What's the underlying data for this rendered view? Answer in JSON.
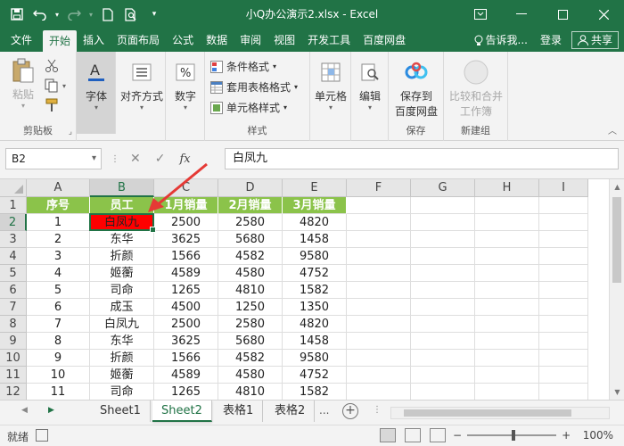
{
  "window": {
    "title": "小Q办公演示2.xlsx - Excel"
  },
  "ribbon_tabs": {
    "file": "文件",
    "home": "开始",
    "insert": "插入",
    "page_layout": "页面布局",
    "formulas": "公式",
    "data": "数据",
    "review": "审阅",
    "view": "视图",
    "developer": "开发工具",
    "baidu": "百度网盘",
    "tell_me": "告诉我...",
    "login": "登录",
    "share": "共享"
  },
  "ribbon": {
    "paste": "粘贴",
    "clipboard": "剪贴板",
    "font": "字体",
    "alignment": "对齐方式",
    "number": "数字",
    "conditional_format": "条件格式",
    "table_format": "套用表格格式",
    "cell_style": "单元格样式",
    "styles": "样式",
    "cells": "单元格",
    "edit": "编辑",
    "save_to_baidu_1": "保存到",
    "save_to_baidu_2": "百度网盘",
    "save": "保存",
    "compare_merge_1": "比较和合并",
    "compare_merge_2": "工作簿",
    "new_group": "新建组"
  },
  "formula_bar": {
    "name_box": "B2",
    "content": "白凤九",
    "fx": "fx"
  },
  "sheet": {
    "columns": [
      "A",
      "B",
      "C",
      "D",
      "E",
      "F",
      "G",
      "H",
      "I"
    ],
    "rows": [
      "1",
      "2",
      "3",
      "4",
      "5",
      "6",
      "7",
      "8",
      "9",
      "10",
      "11",
      "12"
    ],
    "header": [
      "序号",
      "员工",
      "1月销量",
      "2月销量",
      "3月销量"
    ],
    "data": [
      [
        "1",
        "白凤九",
        "2500",
        "2580",
        "4820"
      ],
      [
        "2",
        "东华",
        "3625",
        "5680",
        "1458"
      ],
      [
        "3",
        "折颜",
        "1566",
        "4582",
        "9580"
      ],
      [
        "4",
        "姬蘅",
        "4589",
        "4580",
        "4752"
      ],
      [
        "5",
        "司命",
        "1265",
        "4810",
        "1582"
      ],
      [
        "6",
        "成玉",
        "4500",
        "1250",
        "1350"
      ],
      [
        "7",
        "白凤九",
        "2500",
        "2580",
        "4820"
      ],
      [
        "8",
        "东华",
        "3625",
        "5680",
        "1458"
      ],
      [
        "9",
        "折颜",
        "1566",
        "4582",
        "9580"
      ],
      [
        "10",
        "姬蘅",
        "4589",
        "4580",
        "4752"
      ],
      [
        "11",
        "司命",
        "1265",
        "4810",
        "1582"
      ]
    ]
  },
  "sheet_tabs": {
    "tabs": [
      "Sheet1",
      "Sheet2",
      "表格1",
      "表格2"
    ],
    "more": "..."
  },
  "status": {
    "ready": "就绪",
    "zoom": "100%"
  },
  "colors": {
    "excel_green": "#217346",
    "header_fill": "#8bc34a",
    "highlight_fill": "#ff0000",
    "arrow": "#e53935"
  }
}
